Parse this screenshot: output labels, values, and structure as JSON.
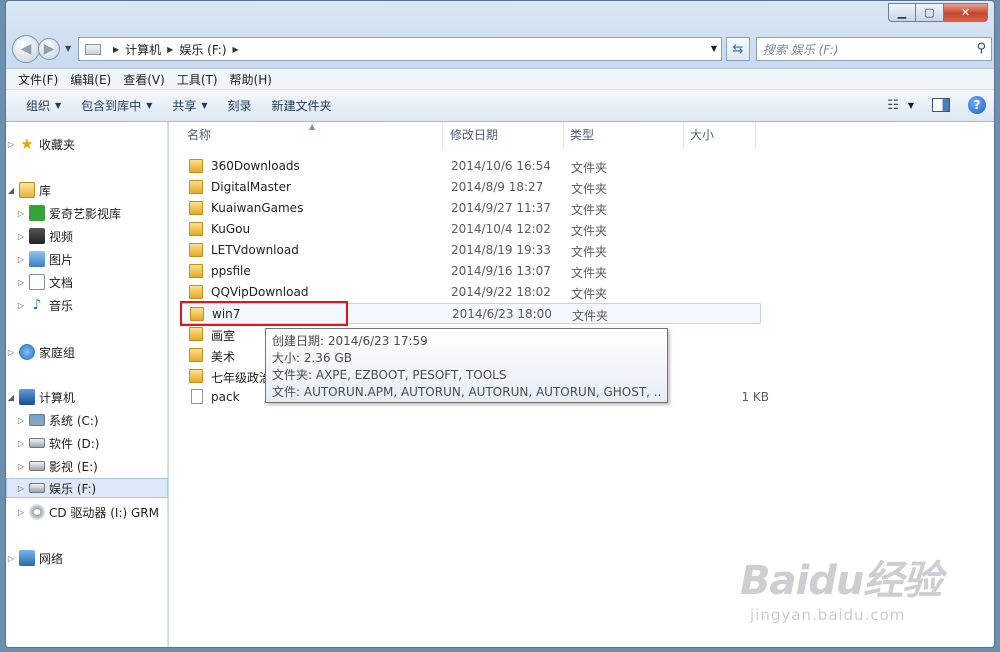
{
  "breadcrumb": {
    "items": [
      "计算机",
      "娱乐 (F:)"
    ]
  },
  "search": {
    "placeholder": "搜索 娱乐 (F:)"
  },
  "menu": [
    "文件(F)",
    "编辑(E)",
    "查看(V)",
    "工具(T)",
    "帮助(H)"
  ],
  "toolbar": {
    "organize": "组织",
    "include": "包含到库中",
    "share": "共享",
    "burn": "刻录",
    "new_folder": "新建文件夹"
  },
  "nav": {
    "favorites": "收藏夹",
    "libraries": "库",
    "lib_items": [
      "爱奇艺影视库",
      "视频",
      "图片",
      "文档",
      "音乐"
    ],
    "homegroup": "家庭组",
    "computer": "计算机",
    "drives": [
      "系统 (C:)",
      "软件 (D:)",
      "影视 (E:)",
      "娱乐 (F:)",
      "CD 驱动器 (I:) GRM"
    ],
    "network": "网络"
  },
  "columns": {
    "name": "名称",
    "date": "修改日期",
    "type": "类型",
    "size": "大小"
  },
  "files": [
    {
      "name": "360Downloads",
      "date": "2014/10/6 16:54",
      "type": "文件夹",
      "size": ""
    },
    {
      "name": "DigitalMaster",
      "date": "2014/8/9 18:27",
      "type": "文件夹",
      "size": ""
    },
    {
      "name": "KuaiwanGames",
      "date": "2014/9/27 11:37",
      "type": "文件夹",
      "size": ""
    },
    {
      "name": "KuGou",
      "date": "2014/10/4 12:02",
      "type": "文件夹",
      "size": ""
    },
    {
      "name": "LETVdownload",
      "date": "2014/8/19 19:33",
      "type": "文件夹",
      "size": ""
    },
    {
      "name": "ppsfile",
      "date": "2014/9/16 13:07",
      "type": "文件夹",
      "size": ""
    },
    {
      "name": "QQVipDownload",
      "date": "2014/9/22 18:02",
      "type": "文件夹",
      "size": ""
    },
    {
      "name": "win7",
      "date": "2014/6/23 18:00",
      "type": "文件夹",
      "size": ""
    },
    {
      "name": "画室",
      "date": "",
      "type": "",
      "size": ""
    },
    {
      "name": "美术",
      "date": "",
      "type": "",
      "size": ""
    },
    {
      "name": "七年级政治",
      "date": "",
      "type": "",
      "size": ""
    },
    {
      "name": "pack",
      "date": "",
      "type": "",
      "size": "1 KB"
    }
  ],
  "tooltip": {
    "created": "创建日期: 2014/6/23 17:59",
    "size": "大小: 2.36 GB",
    "folders": "文件夹: AXPE, EZBOOT, PESOFT, TOOLS",
    "files": "文件: AUTORUN.APM, AUTORUN, AUTORUN, AUTORUN, GHOST, ..."
  },
  "watermark": {
    "logo": "Baidu经验",
    "sub": "jingyan.baidu.com"
  }
}
